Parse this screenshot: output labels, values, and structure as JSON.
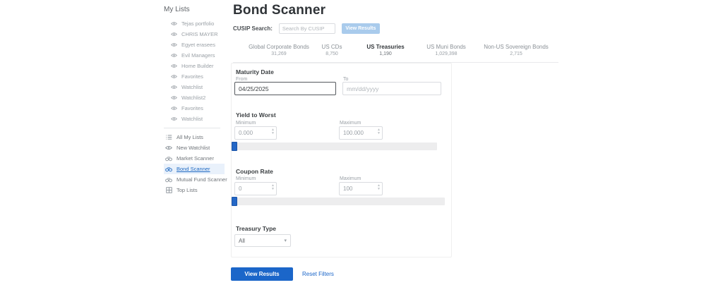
{
  "sidebar": {
    "heading": "My Lists",
    "watchlists": [
      "Tejas portfolio",
      "CHRIS MAYER",
      "Egyet erasees",
      "Evil Managers",
      "Home Builder",
      "Favorites",
      "Watchlist",
      "Watchlist2",
      "Favorites",
      "Watchlist"
    ],
    "menu": [
      {
        "label": "All My Lists",
        "icon": "list-icon"
      },
      {
        "label": "New Watchlist",
        "icon": "eye-icon"
      },
      {
        "label": "Market Scanner",
        "icon": "binoculars-icon"
      },
      {
        "label": "Bond Scanner",
        "icon": "binoculars-icon",
        "active": true
      },
      {
        "label": "Mutual Fund Scanner",
        "icon": "binoculars-icon"
      },
      {
        "label": "Top Lists",
        "icon": "grid-icon"
      }
    ]
  },
  "header": {
    "title": "Bond Scanner"
  },
  "cusip": {
    "label": "CUSIP Search:",
    "placeholder": "Search By CUSIP",
    "button": "View Results"
  },
  "tabs": [
    {
      "label": "Global Corporate Bonds",
      "count": "31,269"
    },
    {
      "label": "US CDs",
      "count": "8,750"
    },
    {
      "label": "US Treasuries",
      "count": "1,190",
      "active": true
    },
    {
      "label": "US Muni Bonds",
      "count": "1,029,398"
    },
    {
      "label": "Non-US Sovereign Bonds",
      "count": "2,715"
    }
  ],
  "filters": {
    "maturity": {
      "heading": "Maturity Date",
      "from_label": "From",
      "from_value": "04/25/2025",
      "to_label": "To",
      "to_placeholder": "mm/dd/yyyy"
    },
    "yield_to_worst": {
      "heading": "Yield to Worst",
      "min_label": "Minimum",
      "min_value": "0.000",
      "max_label": "Maximum",
      "max_value": "100.000"
    },
    "coupon_rate": {
      "heading": "Coupon Rate",
      "min_label": "Minimum",
      "min_value": "0",
      "max_label": "Maximum",
      "max_value": "100"
    },
    "treasury_type": {
      "heading": "Treasury Type",
      "value": "All"
    }
  },
  "actions": {
    "view_results": "View Results",
    "reset_filters": "Reset Filters"
  },
  "colors": {
    "primary_blue": "#1b66c9",
    "active_tab_underline": "#1f6fd4",
    "disabled_button_blue": "#a9cbec",
    "sidebar_active_bg": "#e9f1fb",
    "slider_handle_blue": "#2467c6"
  }
}
